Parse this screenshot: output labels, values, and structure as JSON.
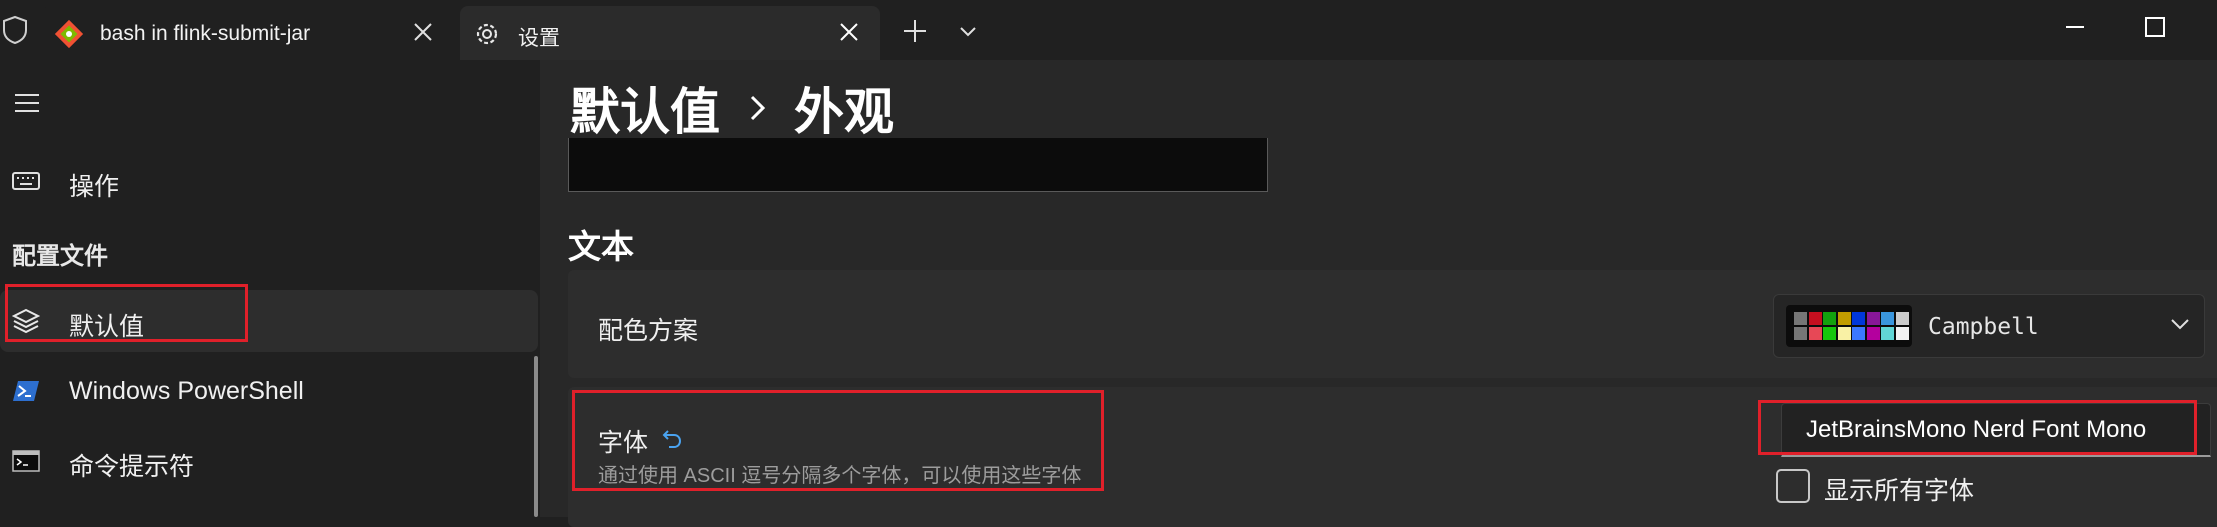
{
  "tabs": [
    {
      "label": "bash in flink-submit-jar",
      "icon": "git-diamond-icon",
      "active": false
    },
    {
      "label": "设置",
      "icon": "gear-icon",
      "active": true
    }
  ],
  "titlebar": {
    "new_tab_icon": "plus-icon",
    "dropdown_icon": "chevron-down-icon",
    "minimize_icon": "minimize-icon",
    "maximize_icon": "maximize-icon"
  },
  "sidebar": {
    "menu_icon": "hamburger-icon",
    "actions_label": "操作",
    "profiles_section": "配置文件",
    "items": [
      {
        "label": "默认值",
        "icon": "layers-icon",
        "selected": true
      },
      {
        "label": "Windows PowerShell",
        "icon": "powershell-icon",
        "selected": false
      },
      {
        "label": "命令提示符",
        "icon": "cmd-icon",
        "selected": false
      }
    ]
  },
  "breadcrumb": {
    "parent": "默认值",
    "current": "外观"
  },
  "section_title": "文本",
  "color_scheme": {
    "label": "配色方案",
    "value": "Campbell",
    "swatch_top": [
      "#767676",
      "#c50f1f",
      "#13a10e",
      "#c19c00",
      "#0037da",
      "#881798",
      "#3a96dd",
      "#cccccc"
    ],
    "swatch_bottom": [
      "#767676",
      "#e74856",
      "#16c60c",
      "#f9f1a5",
      "#3b78ff",
      "#b4009e",
      "#61d6d6",
      "#f2f2f2"
    ]
  },
  "font_face": {
    "label": "字体",
    "description": "通过使用 ASCII 逗号分隔多个字体，可以使用这些字体",
    "value": "JetBrainsMono Nerd Font Mono",
    "show_all_label": "显示所有字体",
    "show_all_checked": false
  },
  "colors": {
    "highlight": "#e0202a",
    "accent": "#4aa3f0"
  }
}
